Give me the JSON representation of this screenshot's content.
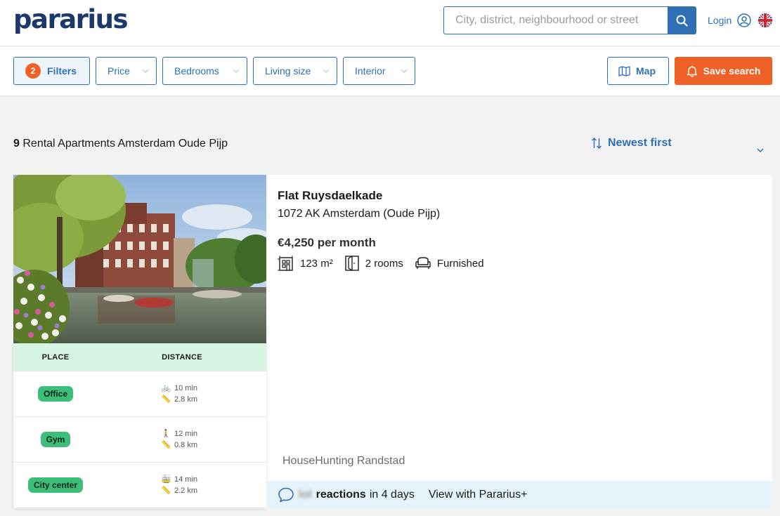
{
  "header": {
    "logo_text": "pararius",
    "search": {
      "placeholder": "City, district, neighbourhood or street",
      "value": ""
    },
    "login_label": "Login"
  },
  "filters": {
    "filters_count": "2",
    "filters_label": "Filters",
    "price_label": "Price",
    "bedrooms_label": "Bedrooms",
    "living_size_label": "Living size",
    "interior_label": "Interior",
    "map_label": "Map",
    "save_search_label": "Save search"
  },
  "results": {
    "count": "9",
    "description": "Rental Apartments Amsterdam Oude Pijp",
    "sort_label": "Newest first"
  },
  "listing": {
    "title": "Flat Ruysdaelkade",
    "address": "1072 AK Amsterdam (Oude Pijp)",
    "price": "€4,250 per month",
    "features": {
      "size": "123 m²",
      "rooms": "2 rooms",
      "interior": "Furnished"
    },
    "agent": "HouseHunting Randstad",
    "reactions": {
      "count_hidden": "lol",
      "label": "reactions",
      "suffix": "in 4 days",
      "plus_link": "View with Pararius+"
    },
    "distance_table": {
      "header_place": "PLACE",
      "header_distance": "DISTANCE",
      "rows": [
        {
          "place": "Office",
          "mode_icon": "bicycle-icon",
          "time": "10 min",
          "distance": "2.8 km"
        },
        {
          "place": "Gym",
          "mode_icon": "walking-icon",
          "time": "12 min",
          "distance": "0.8 km"
        },
        {
          "place": "City center",
          "mode_icon": "tram-icon",
          "time": "14 min",
          "distance": "2.2 km"
        }
      ]
    }
  },
  "colors": {
    "brand_blue": "#2e6fb6",
    "logo_navy": "#1b3a6b",
    "accent_orange": "#ef6126",
    "place_green": "#3dbd7a",
    "table_header_green": "#d7f5e4",
    "reactions_bg": "#e6f3fa"
  }
}
